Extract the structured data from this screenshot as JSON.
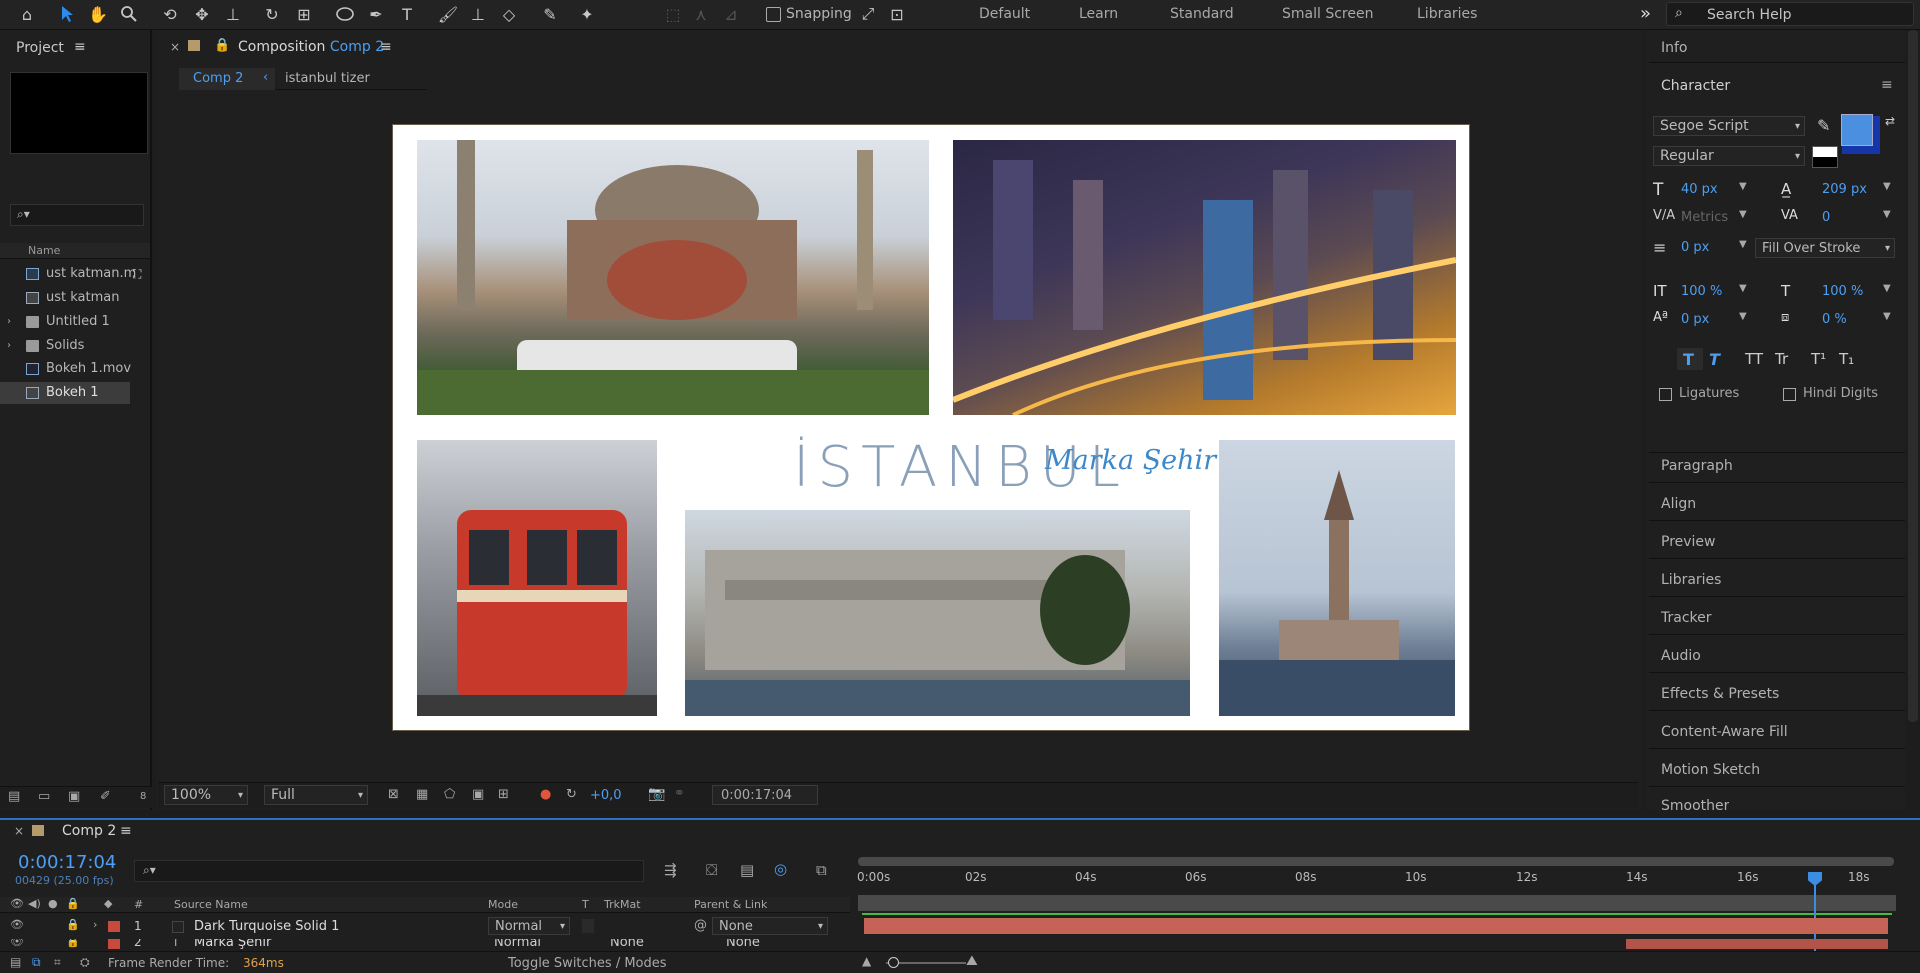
{
  "toolbar": {
    "snapping_label": "Snapping",
    "workspaces": [
      "Default",
      "Learn",
      "Standard",
      "Small Screen",
      "Libraries"
    ],
    "search_placeholder": "Search Help"
  },
  "project": {
    "title": "Project",
    "col_name": "Name",
    "items": [
      {
        "label": "ust katman.m",
        "type": "comp"
      },
      {
        "label": "ust katman",
        "type": "image"
      },
      {
        "label": "Untitled 1",
        "type": "folder"
      },
      {
        "label": "Solids",
        "type": "folder"
      },
      {
        "label": "Bokeh 1.mov",
        "type": "video"
      },
      {
        "label": "Bokeh 1",
        "type": "image"
      }
    ],
    "bit_depth": "8"
  },
  "composition": {
    "tab_prefix": "Composition",
    "tab_name": "Comp 2",
    "breadcrumbs": [
      "Comp 2",
      "istanbul tizer"
    ],
    "title_text": "İSTANBUL",
    "subtitle_text": "Marka Şehir",
    "zoom": "100%",
    "resolution": "Full",
    "exposure": "+0,0",
    "timecode": "0:00:17:04"
  },
  "right_panel": {
    "info": "Info",
    "character": "Character",
    "font_family": "Segoe Script",
    "font_style": "Regular",
    "font_size": "40 px",
    "leading": "209 px",
    "kerning": "Metrics",
    "tracking": "0",
    "stroke_width": "0 px",
    "stroke_mode": "Fill Over Stroke",
    "vscale": "100 %",
    "hscale": "100 %",
    "baseline": "0 px",
    "tsume": "0 %",
    "ligatures": "Ligatures",
    "hindi_digits": "Hindi Digits",
    "style_buttons": [
      "T",
      "T",
      "TT",
      "Tr",
      "T¹",
      "T₁"
    ],
    "fill_color": "#4a8fe0",
    "stroke_color": "#1535a8",
    "sections": [
      "Paragraph",
      "Align",
      "Preview",
      "Libraries",
      "Tracker",
      "Audio",
      "Effects & Presets",
      "Content-Aware Fill",
      "Motion Sketch",
      "Smoother"
    ]
  },
  "timeline": {
    "tab": "Comp 2",
    "timecode": "0:00:17:04",
    "frames": "00429 (25.00 fps)",
    "columns": {
      "num": "#",
      "source": "Source Name",
      "mode": "Mode",
      "t": "T",
      "trkmat": "TrkMat",
      "parent": "Parent & Link"
    },
    "ruler": [
      "0:00s",
      "02s",
      "04s",
      "06s",
      "08s",
      "10s",
      "12s",
      "14s",
      "16s",
      "18s"
    ],
    "layers": [
      {
        "num": "1",
        "name": "Dark Turquoise Solid 1",
        "mode": "Normal",
        "trkmat": "",
        "parent": "None",
        "color": "#c74a3e"
      },
      {
        "num": "2",
        "name": "Marka Şehir",
        "mode": "Normal",
        "trkmat": "None",
        "parent": "None",
        "color": "#c74a3e"
      }
    ],
    "render_label": "Frame Render Time:",
    "render_value": "364ms",
    "toggle_label": "Toggle Switches / Modes"
  }
}
